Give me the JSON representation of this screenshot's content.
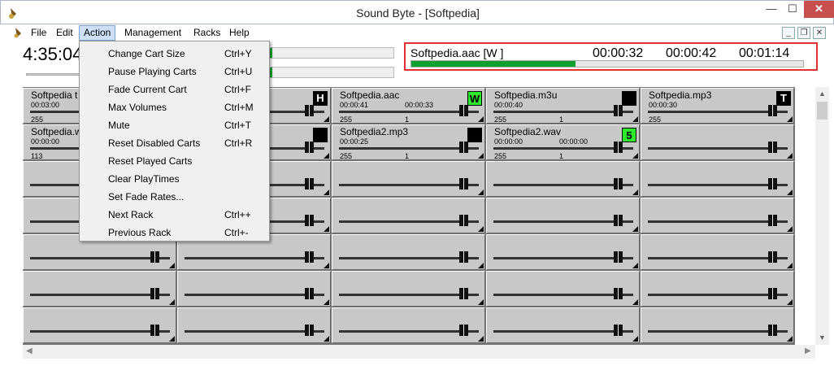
{
  "window": {
    "title": "Sound Byte - [Softpedia]",
    "minimize": "—",
    "maximize": "☐",
    "close": "✕"
  },
  "menubar": {
    "items": [
      "File",
      "Edit",
      "Action",
      "Management",
      "Racks",
      "Help"
    ]
  },
  "mdi": {
    "minimize": "_",
    "restore": "❐",
    "close": "✕"
  },
  "clock": "4:35:04",
  "now_playing": {
    "title": "Softpedia.aac  [W ]",
    "t1": "00:00:32",
    "t2": "00:00:42",
    "t3": "00:01:14",
    "progress": 0.42
  },
  "action_menu": [
    {
      "label": "Change Cart Size",
      "shortcut": "Ctrl+Y"
    },
    {
      "label": "Pause Playing Carts",
      "shortcut": "Ctrl+U"
    },
    {
      "label": "Fade Current Cart",
      "shortcut": "Ctrl+F"
    },
    {
      "label": "Max Volumes",
      "shortcut": "Ctrl+M"
    },
    {
      "label": "Mute",
      "shortcut": "Ctrl+T"
    },
    {
      "label": "Reset Disabled Carts",
      "shortcut": "Ctrl+R"
    },
    {
      "label": "Reset Played Carts",
      "shortcut": ""
    },
    {
      "label": "Clear PlayTimes",
      "shortcut": ""
    },
    {
      "label": "Set Fade Rates...",
      "shortcut": ""
    },
    {
      "label": "Next Rack",
      "shortcut": "Ctrl++"
    },
    {
      "label": "Previous Rack",
      "shortcut": "Ctrl+-"
    }
  ],
  "carts": {
    "c00": {
      "name": "Softpedia t",
      "time": "00:03:00",
      "time2": "",
      "vol": "255",
      "n": "",
      "badge": ""
    },
    "c02": {
      "name": "Softpedia.aac",
      "time": "00:00:41",
      "time2": "00:00:33",
      "vol": "255",
      "n": "1",
      "badge": "W"
    },
    "c03": {
      "name": "Softpedia.m3u",
      "time": "00:00:40",
      "time2": "",
      "vol": "255",
      "n": "1",
      "badge": ""
    },
    "c04": {
      "name": "Softpedia.mp3",
      "time": "00:00:30",
      "time2": "",
      "vol": "255",
      "n": "",
      "badge": "T"
    },
    "c10": {
      "name": "Softpedia.w",
      "time": "00:00:00",
      "time2": "",
      "vol": "113",
      "n": "",
      "badge": ""
    },
    "c12": {
      "name": "Softpedia2.mp3",
      "time": "00:00:25",
      "time2": "",
      "vol": "255",
      "n": "1",
      "badge": ""
    },
    "c13": {
      "name": "Softpedia2.wav",
      "time": "00:00:00",
      "time2": "00:00:00",
      "vol": "255",
      "n": "1",
      "badge": "5"
    },
    "c01_badge": "H"
  },
  "colors": {
    "accent_green": "#10a030",
    "np_border": "#e03030",
    "badge_green": "#2ee82e"
  }
}
